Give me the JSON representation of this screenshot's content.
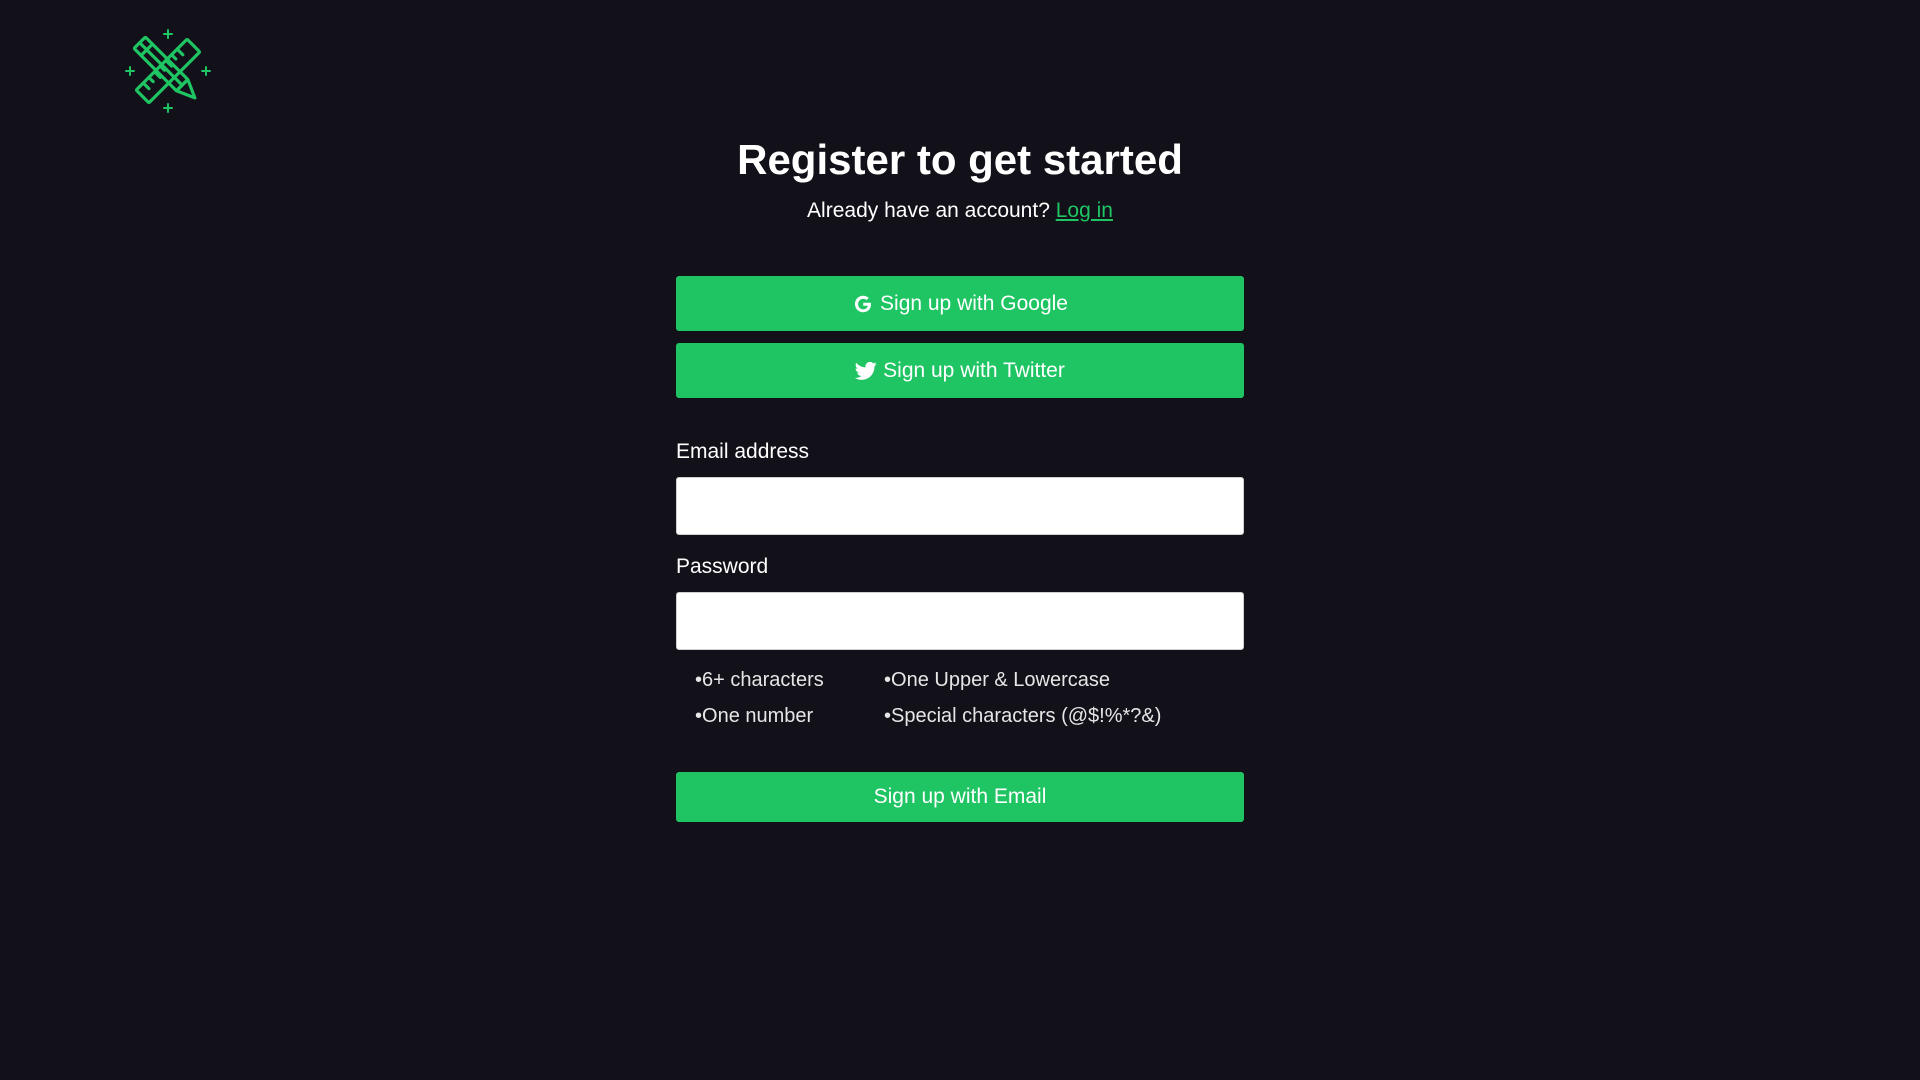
{
  "header": {
    "logo_icon": "pencil-ruler-icon"
  },
  "register": {
    "title": "Register to get started",
    "account_prompt": "Already have an account?",
    "login_link": "Log in"
  },
  "social": {
    "google_label": "Sign up with Google",
    "google_icon": "google-icon",
    "twitter_label": "Sign up with Twitter",
    "twitter_icon": "twitter-icon"
  },
  "form": {
    "email_label": "Email address",
    "email_value": "",
    "email_placeholder": "",
    "password_label": "Password",
    "password_value": "",
    "password_placeholder": "",
    "requirements": [
      "6+ characters",
      "One Upper & Lowercase",
      "One number",
      "Special characters (@$!%*?&)"
    ],
    "submit_label": "Sign up with Email"
  },
  "colors": {
    "background": "#121018",
    "accent": "#1fc463",
    "text": "#ffffff"
  }
}
